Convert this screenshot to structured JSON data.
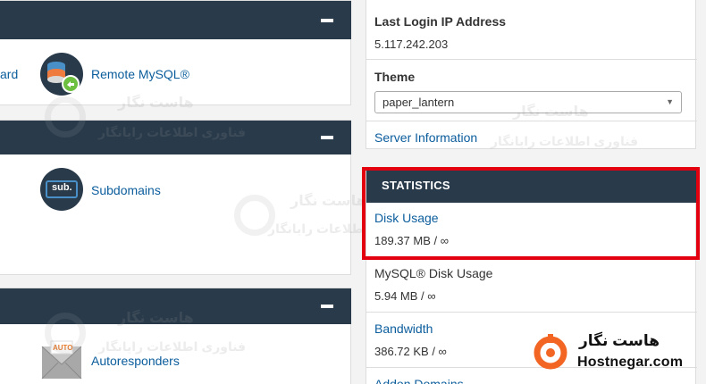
{
  "left_panels": {
    "panel1": {
      "partial_link": "ard",
      "item": {
        "label": "Remote MySQL®",
        "icon": "remote-mysql-icon"
      }
    },
    "panel2": {
      "item": {
        "label": "Subdomains",
        "icon_text": "sub.",
        "icon": "subdomains-icon"
      }
    },
    "panel3": {
      "item": {
        "label": "Autoresponders",
        "icon_text": "AUTO",
        "icon": "autoresponders-icon"
      }
    }
  },
  "general_info": {
    "last_login_label": "Last Login IP Address",
    "last_login_value": "5.117.242.203",
    "theme_label": "Theme",
    "theme_selected": "paper_lantern",
    "server_info_link": "Server Information"
  },
  "statistics": {
    "title": "STATISTICS",
    "items": [
      {
        "label": "Disk Usage",
        "value": "189.37 MB / ∞",
        "is_link": true
      },
      {
        "label": "MySQL® Disk Usage",
        "value": "5.94 MB / ∞",
        "is_link": false
      },
      {
        "label": "Bandwidth",
        "value": "386.72 KB / ∞",
        "is_link": true
      },
      {
        "label": "Addon Domains",
        "value": "",
        "is_link": true
      }
    ]
  },
  "watermark": {
    "fa_title": "هاست نگار",
    "fa_subtitle": "فناوری اطلاعات رایانگار"
  },
  "brand": {
    "fa_name": "هاست نگار",
    "en_name": "Hostnegar.com",
    "color": "#f26522"
  },
  "colors": {
    "header_bg": "#293a4a",
    "link": "#0b5d9c",
    "highlight": "#e3000f"
  }
}
